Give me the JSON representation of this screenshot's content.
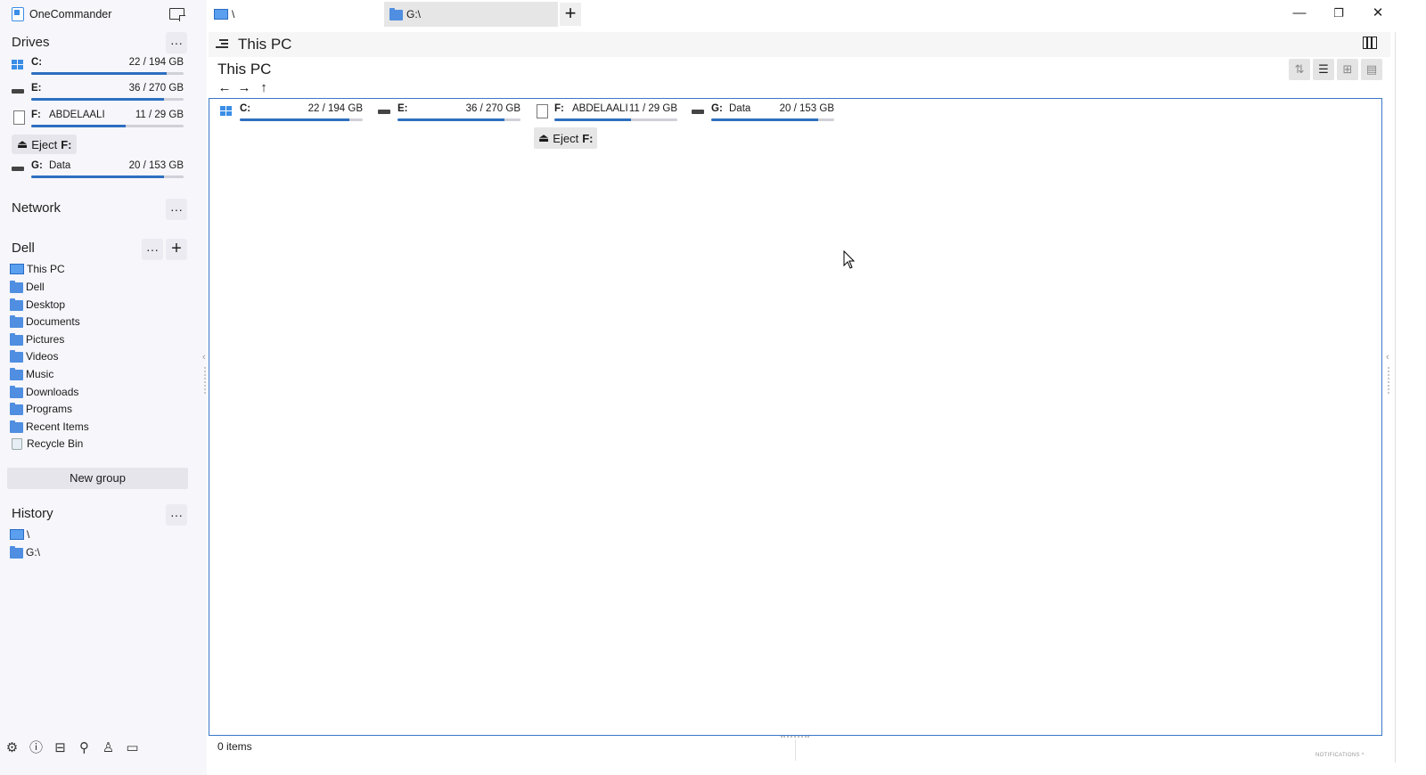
{
  "app": {
    "title": "OneCommander"
  },
  "sidebar": {
    "drives_title": "Drives",
    "drives": [
      {
        "letter": "C:",
        "label": "",
        "size": "22 / 194 GB",
        "used": 0.89,
        "icon": "system-drive-icon"
      },
      {
        "letter": "E:",
        "label": "",
        "size": "36 / 270 GB",
        "used": 0.87,
        "icon": "hard-drive-icon"
      },
      {
        "letter": "F:",
        "label": "ABDELAALI",
        "size": "11 / 29 GB",
        "used": 0.62,
        "icon": "usb-drive-icon"
      },
      {
        "letter": "G:",
        "label": "Data",
        "size": "20 / 153 GB",
        "used": 0.87,
        "icon": "hard-drive-icon"
      }
    ],
    "eject": {
      "label": "Eject",
      "drive": "F:"
    },
    "network_title": "Network",
    "favorites_title": "Dell",
    "favorites": [
      {
        "label": "This PC",
        "icon": "computer-icon"
      },
      {
        "label": "Dell",
        "icon": "folder-icon"
      },
      {
        "label": "Desktop",
        "icon": "folder-icon"
      },
      {
        "label": "Documents",
        "icon": "folder-icon"
      },
      {
        "label": "Pictures",
        "icon": "folder-icon"
      },
      {
        "label": "Videos",
        "icon": "folder-icon"
      },
      {
        "label": "Music",
        "icon": "folder-icon"
      },
      {
        "label": "Downloads",
        "icon": "folder-icon"
      },
      {
        "label": "Programs",
        "icon": "folder-icon"
      },
      {
        "label": "Recent Items",
        "icon": "folder-icon"
      },
      {
        "label": "Recycle Bin",
        "icon": "recycle-bin-icon"
      }
    ],
    "new_group_label": "New group",
    "history_title": "History",
    "history": [
      {
        "label": "\\",
        "icon": "computer-icon"
      },
      {
        "label": "G:\\",
        "icon": "folder-icon"
      }
    ],
    "more_label": "···",
    "plus_label": "+"
  },
  "tabs": [
    {
      "label": "\\",
      "icon": "computer-icon",
      "active": true
    },
    {
      "label": "G:\\",
      "icon": "folder-icon",
      "active": false
    }
  ],
  "tab_add_label": "+",
  "window_controls": {
    "minimize": "—",
    "restore": "❐",
    "close": "✕"
  },
  "pane": {
    "header_title": "This PC",
    "location_title": "This PC",
    "nav": {
      "back": "←",
      "forward": "→",
      "up": "↑"
    },
    "status": "0 items",
    "notifications_label": "NOTIFICATIONS ^"
  },
  "colors": {
    "accent": "#3a78c8",
    "bar_fill": "#2d6fc0",
    "folder": "#4f8ee0",
    "sidebar_bg": "#f7f6fb"
  }
}
